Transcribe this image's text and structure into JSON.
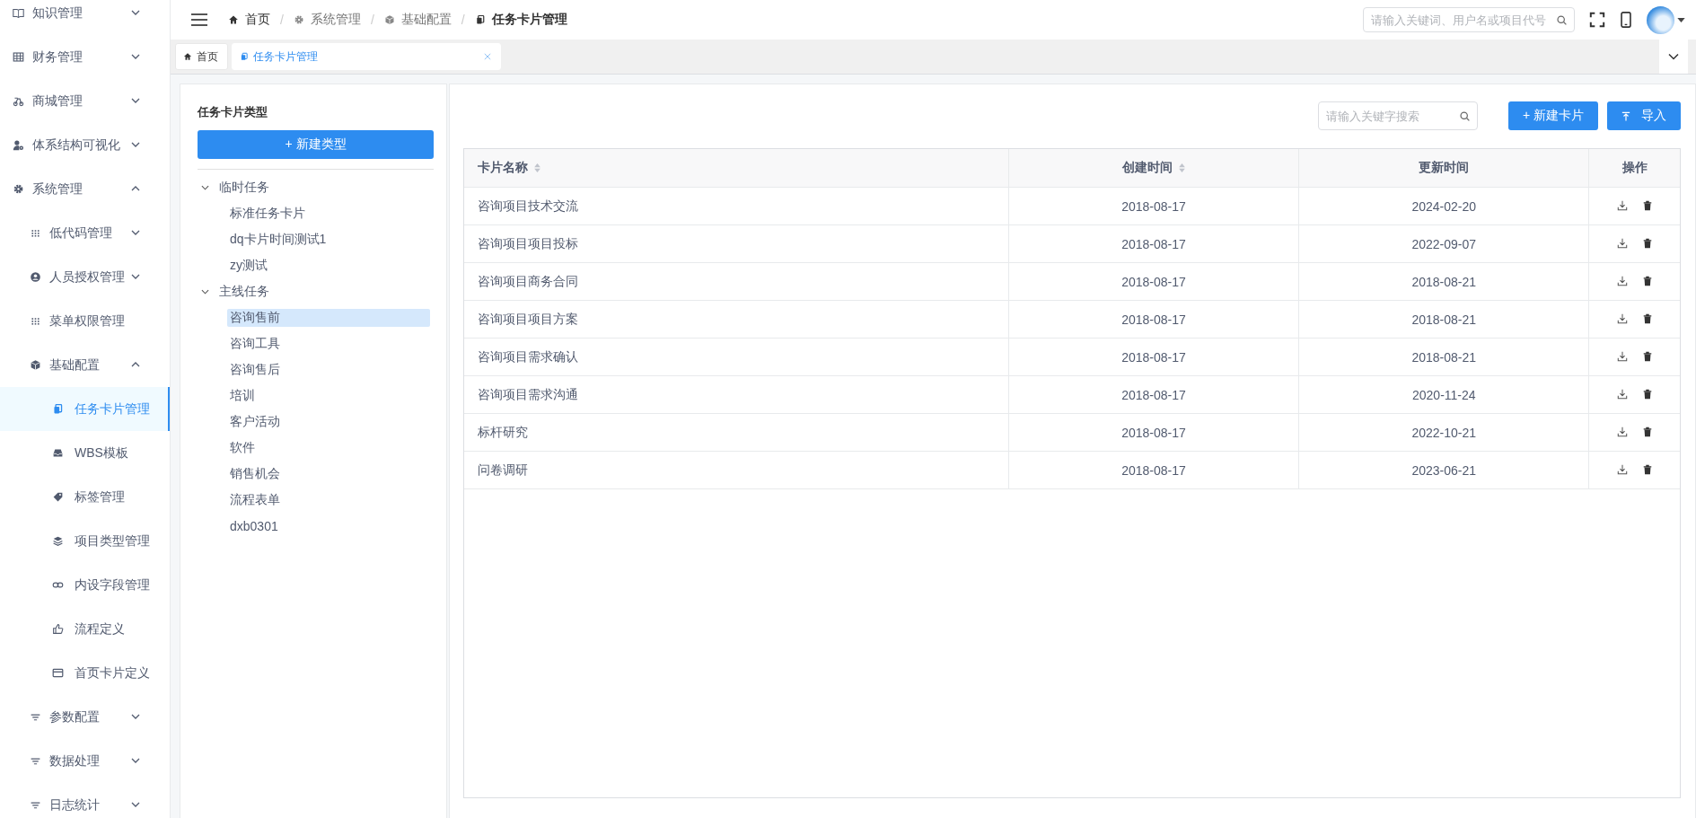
{
  "sidebar": {
    "items": [
      {
        "label": "知识管理",
        "expanded": false,
        "selected": false
      },
      {
        "label": "财务管理",
        "expanded": false,
        "selected": false
      },
      {
        "label": "商城管理",
        "expanded": false,
        "selected": false
      },
      {
        "label": "体系结构可视化",
        "expanded": false,
        "selected": false
      },
      {
        "label": "系统管理",
        "expanded": true,
        "selected": false,
        "children": [
          {
            "label": "低代码管理",
            "expanded": false,
            "selected": false
          },
          {
            "label": "人员授权管理",
            "expanded": false,
            "selected": false
          },
          {
            "label": "菜单权限管理",
            "selected": false
          },
          {
            "label": "基础配置",
            "expanded": true,
            "selected": false,
            "children": [
              {
                "label": "任务卡片管理",
                "selected": true
              },
              {
                "label": "WBS模板",
                "selected": false
              },
              {
                "label": "标签管理",
                "selected": false
              },
              {
                "label": "项目类型管理",
                "selected": false
              },
              {
                "label": "内设字段管理",
                "selected": false
              },
              {
                "label": "流程定义",
                "selected": false
              },
              {
                "label": "首页卡片定义",
                "selected": false
              }
            ]
          },
          {
            "label": "参数配置",
            "expanded": false,
            "selected": false
          },
          {
            "label": "数据处理",
            "expanded": false,
            "selected": false
          },
          {
            "label": "日志统计",
            "expanded": false,
            "selected": false
          }
        ]
      }
    ]
  },
  "breadcrumb": [
    {
      "label": "首页",
      "current": false
    },
    {
      "separator": "/",
      "label": "系统管理",
      "current": false
    },
    {
      "separator": "/",
      "label": "基础配置",
      "current": false
    },
    {
      "separator": "/",
      "label": "任务卡片管理",
      "current": true
    }
  ],
  "header_search": {
    "placeholder": "请输入关键词、用户名或项目代号"
  },
  "tabs": [
    {
      "label": "首页",
      "selected": false
    },
    {
      "label": "任务卡片管理",
      "selected": true
    }
  ],
  "type_panel": {
    "title": "任务卡片类型",
    "new_button": "+ 新建类型",
    "tree": [
      {
        "label": "临时任务",
        "expanded": true,
        "selected": false,
        "children": [
          {
            "label": "标准任务卡片",
            "selected": false
          },
          {
            "label": "dq卡片时间测试1",
            "selected": false
          },
          {
            "label": "zy测试",
            "selected": false
          }
        ]
      },
      {
        "label": "主线任务",
        "expanded": true,
        "selected": false,
        "children": [
          {
            "label": "咨询售前",
            "selected": true
          },
          {
            "label": "咨询工具",
            "selected": false
          },
          {
            "label": "咨询售后",
            "selected": false
          },
          {
            "label": "培训",
            "selected": false
          },
          {
            "label": "客户活动",
            "selected": false
          },
          {
            "label": "软件",
            "selected": false
          },
          {
            "label": "销售机会",
            "selected": false
          },
          {
            "label": "流程表单",
            "selected": false
          },
          {
            "label": "dxb0301",
            "selected": false
          }
        ]
      }
    ]
  },
  "card_search": {
    "placeholder": "请输入关键字搜索"
  },
  "new_card_button": "+ 新建卡片",
  "import_button": "导入",
  "table": {
    "columns": [
      {
        "label": "卡片名称",
        "sortable": true
      },
      {
        "label": "创建时间",
        "sortable": true
      },
      {
        "label": "更新时间",
        "sortable": false
      },
      {
        "label": "操作",
        "sortable": false
      }
    ],
    "rows": [
      {
        "name": "咨询项目技术交流",
        "created": "2018-08-17",
        "updated": "2024-02-20"
      },
      {
        "name": "咨询项目项目投标",
        "created": "2018-08-17",
        "updated": "2022-09-07"
      },
      {
        "name": "咨询项目商务合同",
        "created": "2018-08-17",
        "updated": "2018-08-21"
      },
      {
        "name": "咨询项目项目方案",
        "created": "2018-08-17",
        "updated": "2018-08-21"
      },
      {
        "name": "咨询项目需求确认",
        "created": "2018-08-17",
        "updated": "2018-08-21"
      },
      {
        "name": "咨询项目需求沟通",
        "created": "2018-08-17",
        "updated": "2020-11-24"
      },
      {
        "name": "标杆研究",
        "created": "2018-08-17",
        "updated": "2022-10-21"
      },
      {
        "name": "问卷调研",
        "created": "2018-08-17",
        "updated": "2023-06-21"
      }
    ]
  }
}
